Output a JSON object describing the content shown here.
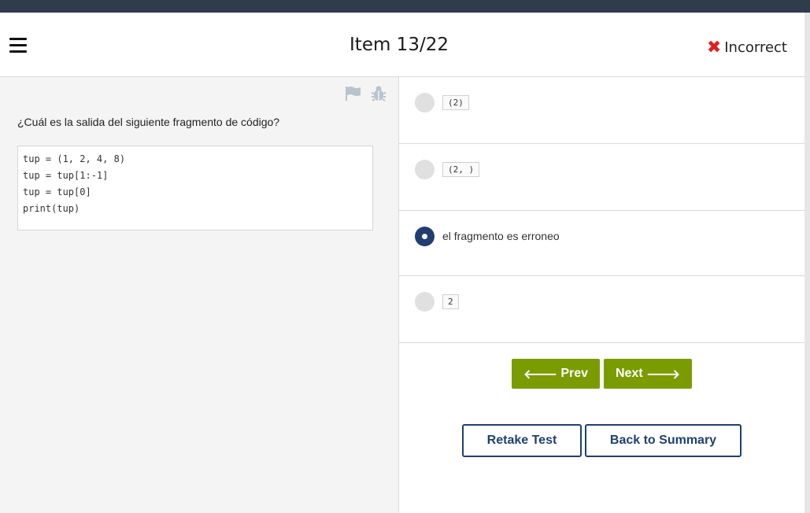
{
  "header": {
    "menu_icon": "hamburger-menu-icon",
    "title": "Item 13/22",
    "status_icon": "x-icon",
    "status_icon_glyph": "✖",
    "status_label": "Incorrect",
    "status_color": "#e02020"
  },
  "question": {
    "flag_icon": "flag-icon",
    "bug_icon": "bug-icon",
    "text": "¿Cuál es la salida del siguiente fragmento de código?",
    "code_lines": [
      "tup = (1, 2, 4, 8)",
      "tup = tup[1:-1]",
      "tup = tup[0]",
      "print(tup)"
    ]
  },
  "options": [
    {
      "label": "(2)",
      "is_code": true,
      "selected": false
    },
    {
      "label": "(2, )",
      "is_code": true,
      "selected": false
    },
    {
      "label": "el fragmento es erroneo",
      "is_code": false,
      "selected": true
    },
    {
      "label": "2",
      "is_code": true,
      "selected": false
    }
  ],
  "nav": {
    "prev_icon": "arrow-left-icon",
    "prev_label": "Prev",
    "next_label": "Next",
    "next_icon": "arrow-right-icon",
    "retake_label": "Retake Test",
    "summary_label": "Back to Summary"
  },
  "colors": {
    "top_bar": "#2f3c4c",
    "accent_green": "#7a9c00",
    "accent_navy": "#1f3f73"
  }
}
